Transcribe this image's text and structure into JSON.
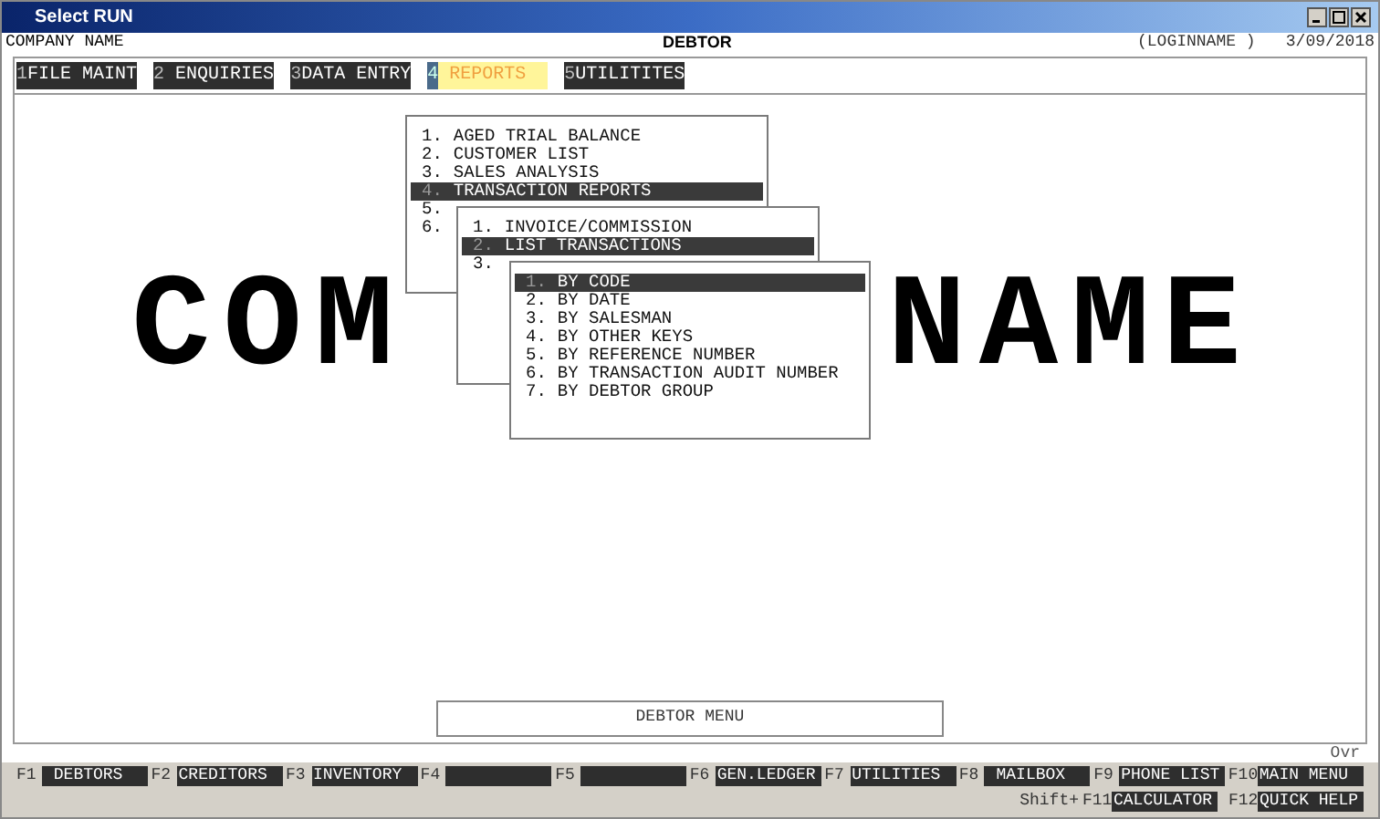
{
  "window": {
    "title": "Select RUN"
  },
  "header": {
    "company": "COMPANY NAME",
    "module": "DEBTOR",
    "login": "(LOGINNAME )",
    "date": "3/09/2018"
  },
  "menu_bar": [
    {
      "key": "1",
      "label": "FILE MAINT",
      "selected": false
    },
    {
      "key": "2",
      "label": " ENQUIRIES",
      "selected": false
    },
    {
      "key": "3",
      "label": "DATA ENTRY",
      "selected": false
    },
    {
      "key": "4",
      "label": " REPORTS  ",
      "selected": true
    },
    {
      "key": "5",
      "label": "UTILITITES",
      "selected": false
    }
  ],
  "banner": {
    "left": "COM",
    "right": "NAME"
  },
  "menus": [
    {
      "items": [
        {
          "number": "1.",
          "label": "AGED TRIAL BALANCE",
          "selected": false
        },
        {
          "number": "2.",
          "label": "CUSTOMER LIST",
          "selected": false
        },
        {
          "number": "3.",
          "label": "SALES ANALYSIS",
          "selected": false
        },
        {
          "number": "4.",
          "label": "TRANSACTION REPORTS",
          "selected": true
        },
        {
          "number": "5.",
          "selected": false
        },
        {
          "number": "6.",
          "selected": false
        }
      ]
    },
    {
      "items": [
        {
          "number": "1.",
          "label": "INVOICE/COMMISSION",
          "selected": false
        },
        {
          "number": "2.",
          "label": "LIST TRANSACTIONS",
          "selected": true
        },
        {
          "number": "3.",
          "selected": false
        }
      ]
    },
    {
      "items": [
        {
          "number": "1.",
          "label": "BY CODE",
          "selected": true
        },
        {
          "number": "2.",
          "label": "BY DATE",
          "selected": false
        },
        {
          "number": "3.",
          "label": "BY SALESMAN",
          "selected": false
        },
        {
          "number": "4.",
          "label": "BY OTHER KEYS",
          "selected": false
        },
        {
          "number": "5.",
          "label": "BY REFERENCE NUMBER",
          "selected": false
        },
        {
          "number": "6.",
          "label": "BY TRANSACTION AUDIT NUMBER",
          "selected": false
        },
        {
          "number": "7.",
          "label": "BY DEBTOR GROUP",
          "selected": false
        }
      ]
    }
  ],
  "menu_title": "DEBTOR MENU",
  "mode": "Ovr",
  "function_keys": [
    {
      "key": "F1",
      "label": " DEBTORS"
    },
    {
      "key": "F2",
      "label": "CREDITORS"
    },
    {
      "key": "F3",
      "label": "INVENTORY"
    },
    {
      "key": "F4"
    },
    {
      "key": "F5"
    },
    {
      "key": "F6",
      "label": "GEN.LEDGER"
    },
    {
      "key": "F7",
      "label": "UTILITIES"
    },
    {
      "key": "F8",
      "label": " MAILBOX"
    },
    {
      "key": "F9",
      "label": "PHONE LIST"
    },
    {
      "key": "F10",
      "label": "MAIN MENU"
    }
  ],
  "shift_label": "Shift+",
  "shift_keys": [
    {
      "key": "F11",
      "label": "CALCULATOR"
    },
    {
      "key": "F12",
      "label": "QUICK HELP"
    }
  ]
}
